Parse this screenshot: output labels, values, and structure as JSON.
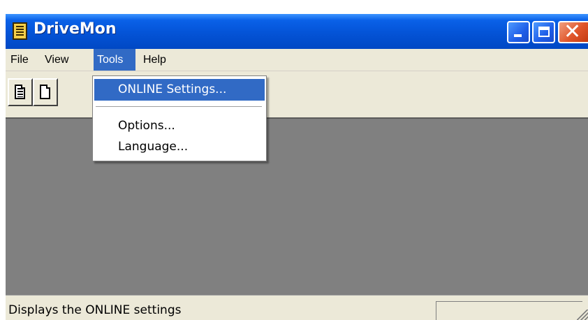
{
  "window": {
    "title": "DriveMon"
  },
  "title_bar_buttons": {
    "minimize": "minimize-icon",
    "maximize": "maximize-icon",
    "close": "close-icon",
    "close_glyph": "✕"
  },
  "menubar": {
    "items": [
      "File",
      "View",
      "Tools",
      "Help"
    ],
    "active": "Tools"
  },
  "toolbar": {
    "buttons": [
      "document-lined-icon",
      "document-blank-icon"
    ]
  },
  "tools_menu": {
    "items": [
      {
        "label": "ONLINE Settings...",
        "highlighted": true
      },
      {
        "label": "Options...",
        "highlighted": false
      },
      {
        "label": "Language...",
        "highlighted": false
      }
    ]
  },
  "statusbar": {
    "text": "Displays the ONLINE settings"
  },
  "colors": {
    "title_bar": "#0453d6",
    "menu_highlight": "#316ac5",
    "client_area": "#808080",
    "chrome": "#ece9d8"
  }
}
